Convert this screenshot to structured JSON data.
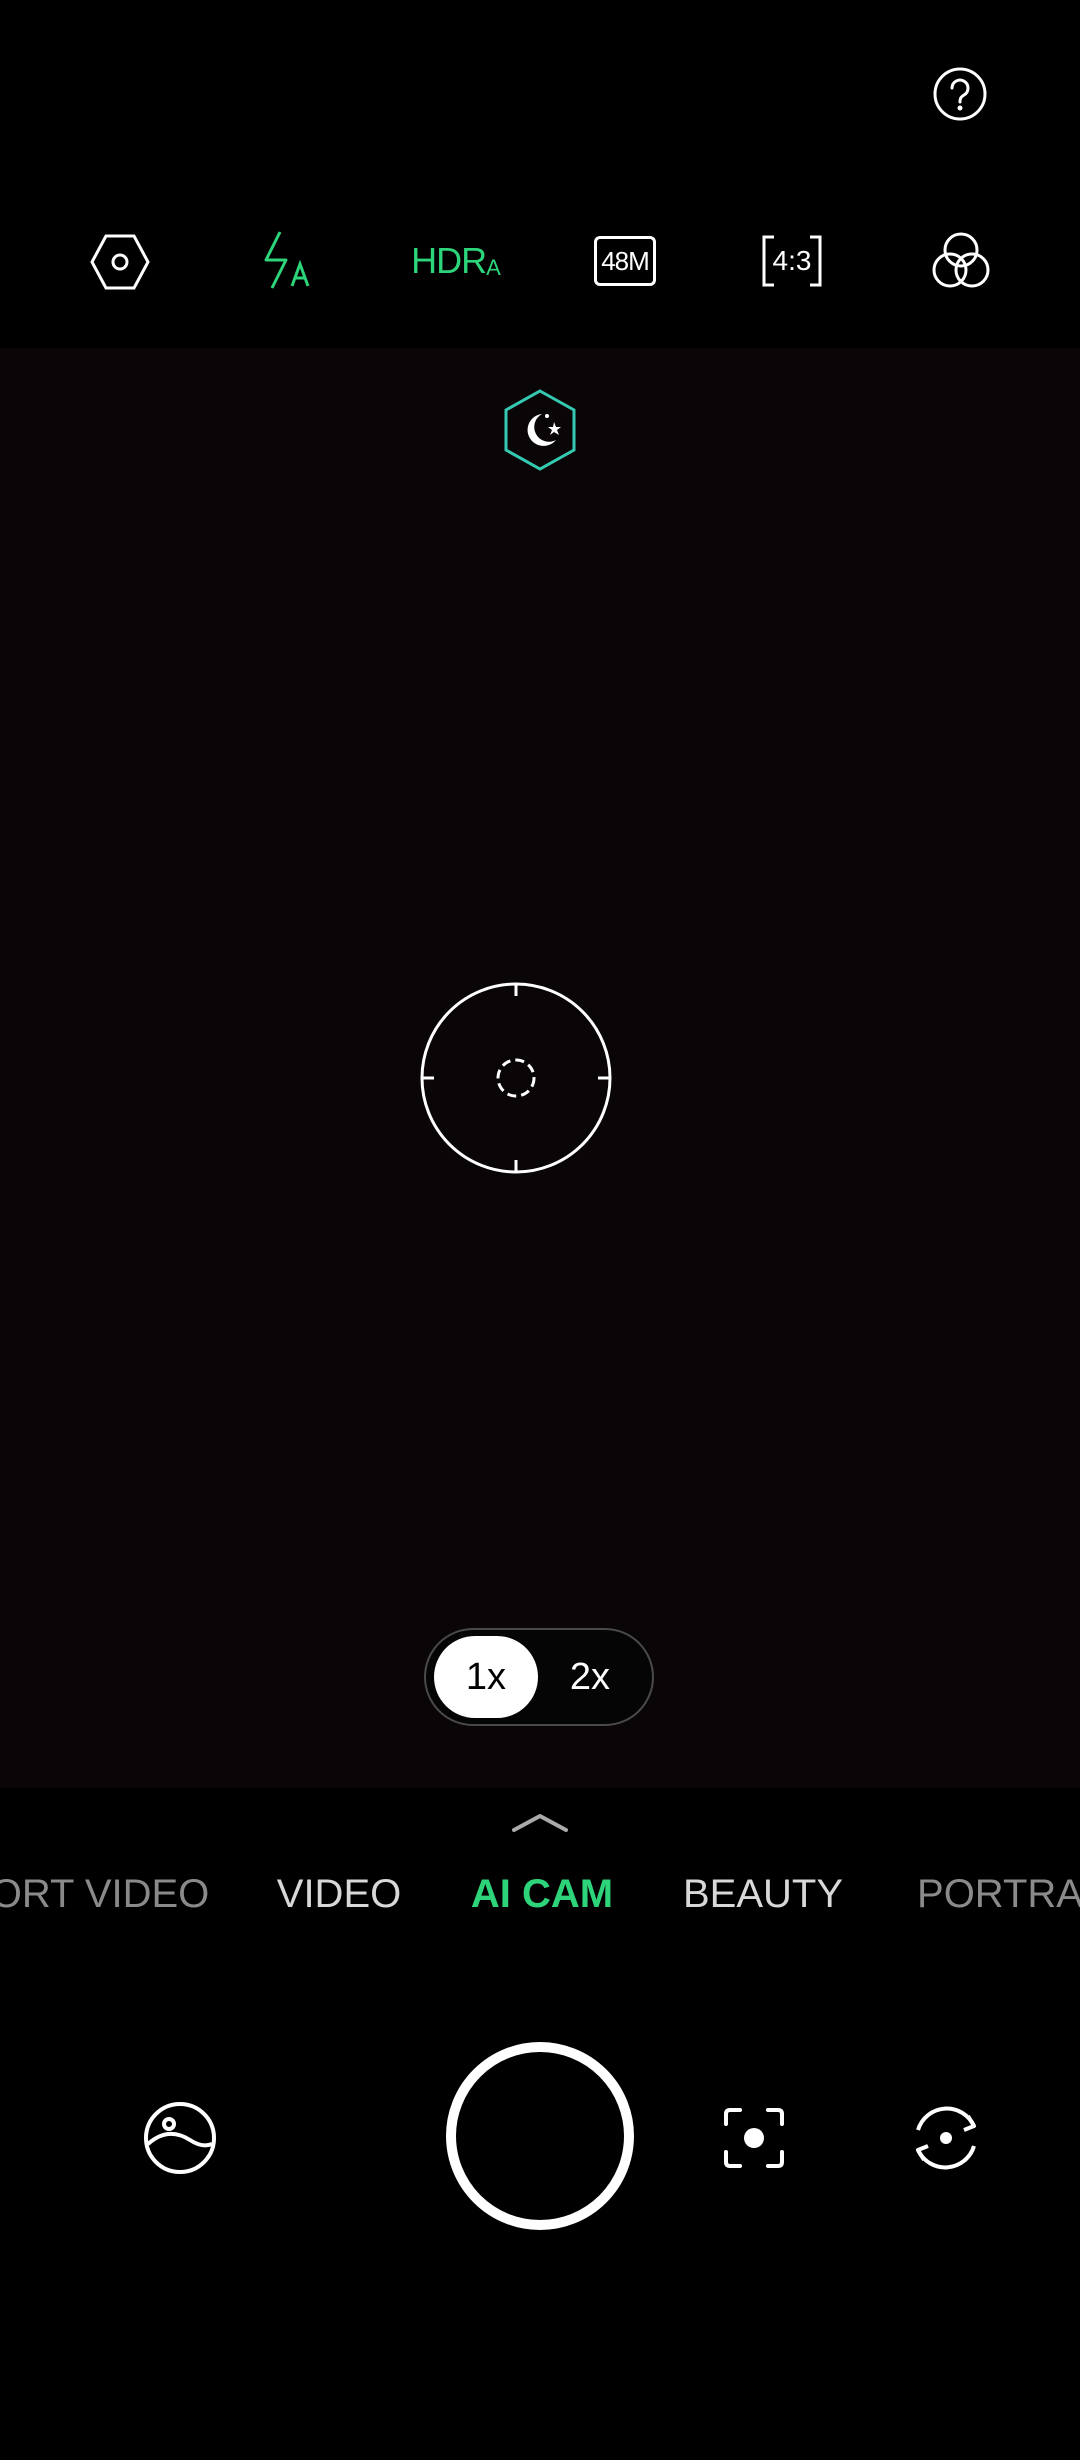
{
  "top_bar": {
    "help_icon": "question-circle-icon"
  },
  "settings_bar": {
    "items": [
      {
        "icon": "settings-hexagon-icon"
      },
      {
        "icon": "flash-auto-icon",
        "color": "#2dd47a"
      },
      {
        "icon": "hdr-auto-icon",
        "label": "HDR",
        "sub": "A",
        "color": "#2dd47a"
      },
      {
        "icon": "resolution-48m-icon",
        "label": "48M"
      },
      {
        "icon": "aspect-ratio-icon",
        "label": "4:3"
      },
      {
        "icon": "filters-icon"
      }
    ]
  },
  "viewfinder": {
    "night_mode_icon": "night-mode-moon-icon",
    "focus_reticle": "focus-reticle-icon"
  },
  "zoom": {
    "options": [
      "1x",
      "2x"
    ],
    "selected": "1x"
  },
  "modes": {
    "items": [
      "ORT VIDEO",
      "VIDEO",
      "AI CAM",
      "BEAUTY",
      "PORTRA"
    ],
    "active": "AI CAM",
    "accent": "#2dd47a"
  },
  "bottom_bar": {
    "gallery_icon": "gallery-icon",
    "shutter": "shutter-button",
    "lens_icon": "scan-lens-icon",
    "switch_camera_icon": "switch-camera-icon"
  }
}
